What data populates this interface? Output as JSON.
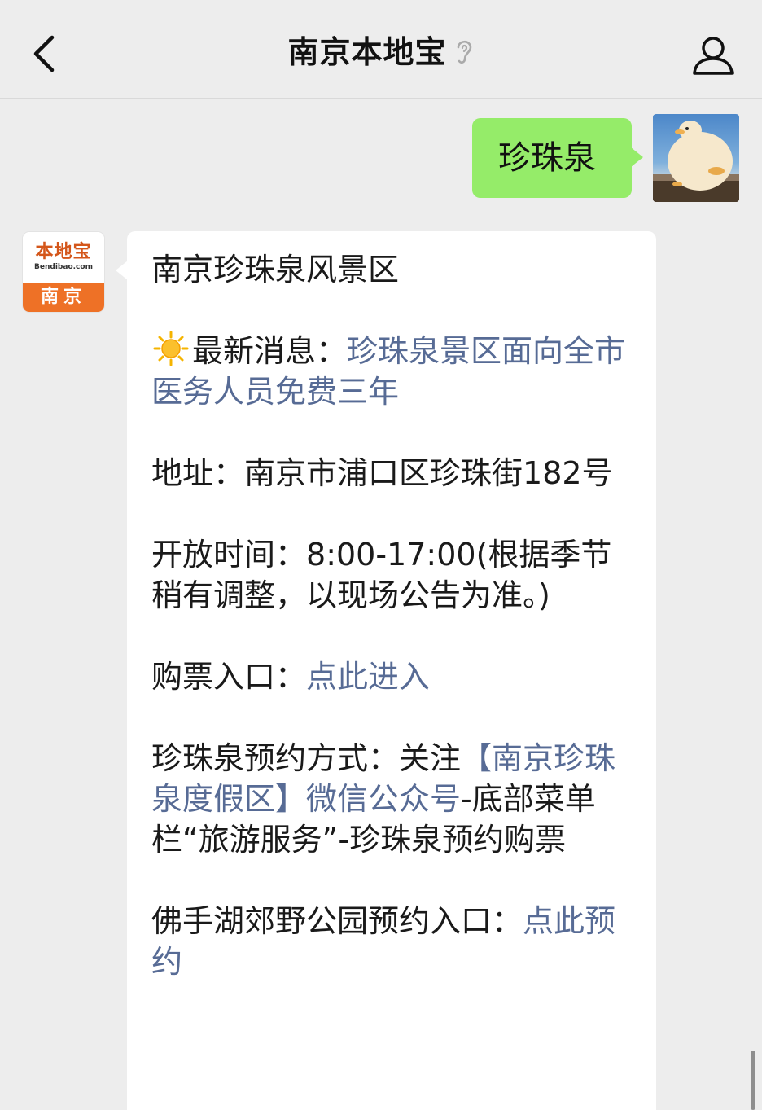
{
  "header": {
    "title": "南京本地宝",
    "back_icon": "chevron-left-icon",
    "mode_icon": "ear-icon",
    "profile_icon": "user-icon"
  },
  "outgoing": {
    "text": "珍珠泉",
    "bubble_color": "#95ec69"
  },
  "incoming": {
    "avatar": {
      "logo_text": "本地宝",
      "logo_sub": "Bendibao.com",
      "city": "南京"
    },
    "title": "南京珍珠泉风景区",
    "news_label": "最新消息：",
    "news_link": "珍珠泉景区面向全市医务人员免费三年",
    "address_label": "地址：",
    "address_value": "南京市浦口区珍珠街182号",
    "hours_label": "开放时间：",
    "hours_value": "8:00-17:00(根据季节稍有调整，以现场公告为准。)",
    "ticket_label": "购票入口：",
    "ticket_link": "点此进入",
    "reserve_label": "珍珠泉预约方式：关注",
    "reserve_link": "【南京珍珠泉度假区】微信公众号",
    "reserve_rest": "-底部菜单栏“旅游服务”-珍珠泉预约购票",
    "foshou_label": "佛手湖郊野公园预约入口：",
    "foshou_link": "点此预约",
    "link_color": "#576b95"
  }
}
